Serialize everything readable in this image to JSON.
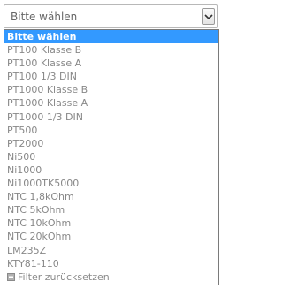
{
  "select": {
    "value": "Bitte wählen",
    "button_icon": "chevron-down-icon"
  },
  "options": [
    "Bitte wählen",
    "PT100 Klasse B",
    "PT100 Klasse A",
    "PT100 1/3 DIN",
    "PT1000 Klasse B",
    "PT1000 Klasse A",
    "PT1000 1/3 DIN",
    "PT500",
    "PT2000",
    "Ni500",
    "Ni1000",
    "Ni1000TK5000",
    "NTC 1,8kOhm",
    "NTC 5kOhm",
    "NTC 10kOhm",
    "NTC 20kOhm",
    "LM235Z",
    "KTY81-110"
  ],
  "reset": {
    "label": "Filter zurücksetzen",
    "icon": "filter-reset-icon"
  },
  "colors": {
    "highlight": "#3399ff",
    "text": "#888888"
  }
}
